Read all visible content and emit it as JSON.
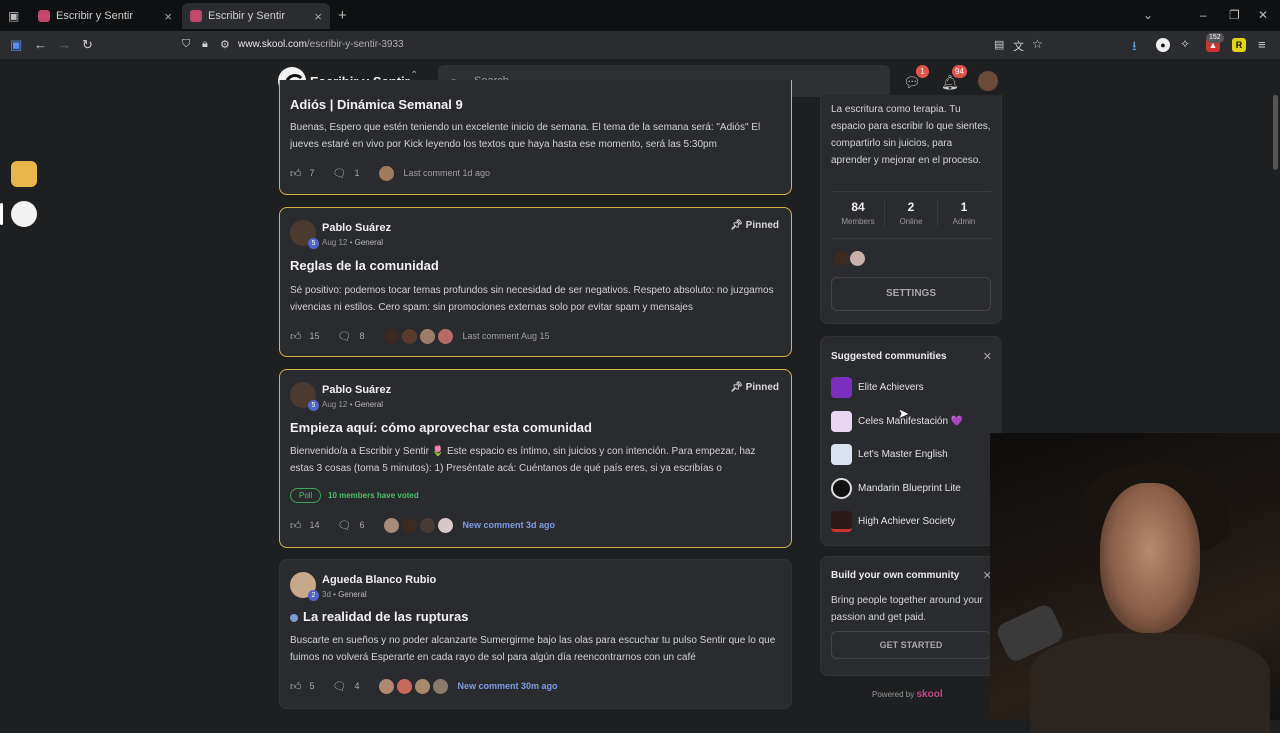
{
  "browser": {
    "tabs": [
      {
        "title": "Escribir y Sentir",
        "close": "×"
      },
      {
        "title": "Escribir y Sentir",
        "close": "×"
      }
    ],
    "new_tab": "+",
    "url_host": "www.skool.com",
    "url_path": "/escribir-y-sentir-3933",
    "ext_badge": "152"
  },
  "header": {
    "brand": "Escribir y Sentir",
    "search_placeholder": "Search",
    "chat_badge": "1",
    "notif_badge": "94"
  },
  "posts": [
    {
      "title": "Adiós | Dinámica Semanal 9",
      "body": "Buenas, Espero que estén teniendo un excelente inicio de semana. El tema de la semana será: \"Adiós\" El jueves estaré en vivo por Kick leyendo los textos que haya hasta ese momento, será las 5:30pm",
      "likes": "7",
      "comments": "1",
      "activity": "Last comment 1d ago"
    },
    {
      "author": "Pablo Suárez",
      "level": "5",
      "date": "Aug 12",
      "category": "General",
      "pinned": "Pinned",
      "title": "Reglas de la comunidad",
      "body": "Sé positivo: podemos tocar temas profundos sin necesidad de ser negativos. Respeto absoluto: no juzgamos vivencias ni estilos. Cero spam: sin promociones externas solo por evitar spam y mensajes",
      "likes": "15",
      "comments": "8",
      "activity": "Last comment Aug 15"
    },
    {
      "author": "Pablo Suárez",
      "level": "5",
      "date": "Aug 12",
      "category": "General",
      "pinned": "Pinned",
      "title": "Empieza aquí: cómo aprovechar esta comunidad",
      "body": "Bienvenido/a a Escribir y Sentir 🌷 Este espacio es íntimo, sin juicios y con intención. Para empezar, haz estas 3 cosas (toma 5 minutos): 1) Preséntate acá: Cuéntanos de qué país eres, si ya escribías o",
      "poll": "Poll",
      "poll_votes": "10 members have voted",
      "likes": "14",
      "comments": "6",
      "activity": "New comment 3d ago"
    },
    {
      "author": "Agueda Blanco Rubio",
      "level": "2",
      "date": "3d",
      "category": "General",
      "title": "La realidad de las rupturas",
      "body": "Buscarte en sueños y no poder alcanzarte Sumergirme bajo las olas para escuchar tu pulso Sentir que lo que fuimos no volverá Esperarte en cada rayo de sol para algún día reencontrarnos con un café",
      "likes": "5",
      "comments": "4",
      "activity": "New comment 30m ago"
    }
  ],
  "sidebar": {
    "about": "La escritura como terapia. Tu espacio para escribir lo que sientes, compartirlo sin juicios, para aprender y mejorar en el proceso.",
    "stats": [
      {
        "value": "84",
        "label": "Members"
      },
      {
        "value": "2",
        "label": "Online"
      },
      {
        "value": "1",
        "label": "Admin"
      }
    ],
    "settings": "SETTINGS",
    "suggested_title": "Suggested communities",
    "communities": [
      {
        "name": "Elite Achievers",
        "color": "#7b2fbf"
      },
      {
        "name": "Celes Manifestación 💜",
        "color": "#e8d6f2"
      },
      {
        "name": "Let's Master English",
        "color": "#d9e3f0"
      },
      {
        "name": "Mandarin Blueprint Lite",
        "color": "#111111"
      },
      {
        "name": "High Achiever Society",
        "color": "#2a1a1a"
      }
    ],
    "build_title": "Build your own community",
    "build_text": "Bring people together around your passion and get paid.",
    "build_cta": "GET STARTED",
    "powered_by": "Powered by",
    "powered_brand": "skool"
  }
}
